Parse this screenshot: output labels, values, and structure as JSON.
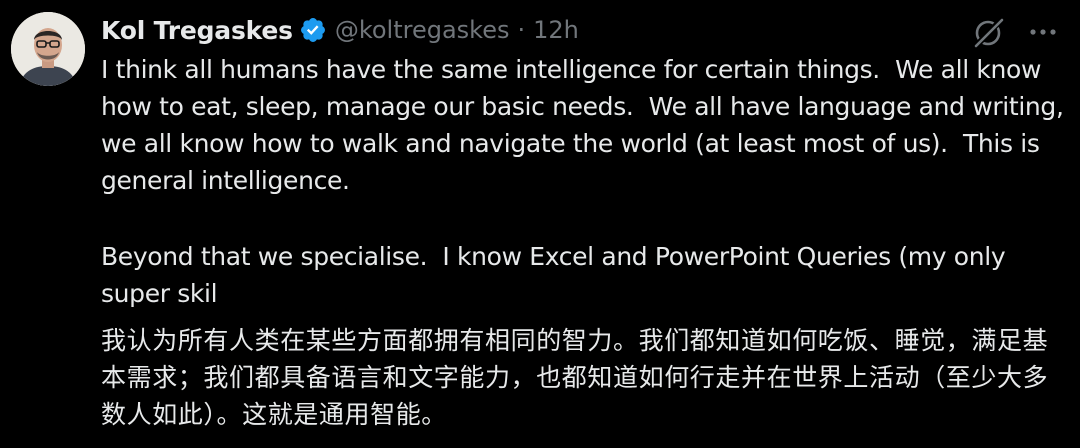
{
  "tweet": {
    "author": {
      "display_name": "Kol Tregaskes",
      "handle": "@koltregaskes",
      "verified_icon": "verified-badge-icon"
    },
    "separator": "·",
    "timestamp": "12h",
    "actions": {
      "grok_icon": "grok-icon",
      "more_icon": "more-options-icon"
    },
    "paragraphs": [
      "I think all humans have the same intelligence for certain things.  We all know how to eat, sleep, manage our basic needs.  We all have language and writing, we all know how to walk and navigate the world (at least most of us).  This is general intelligence.",
      "Beyond that we specialise.  I know Excel and PowerPoint Queries (my only super skil",
      "我认为所有人类在某些方面都拥有相同的智力。我们都知道如何吃饭、睡觉，满足基本需求；我们都具备语言和文字能力，也都知道如何行走并在世界上活动（至少大多数人如此）。这就是通用智能。"
    ]
  },
  "colors": {
    "background": "#000000",
    "text_primary": "#e7e9ea",
    "text_secondary": "#71767b",
    "verified_blue": "#1d9bf0"
  }
}
